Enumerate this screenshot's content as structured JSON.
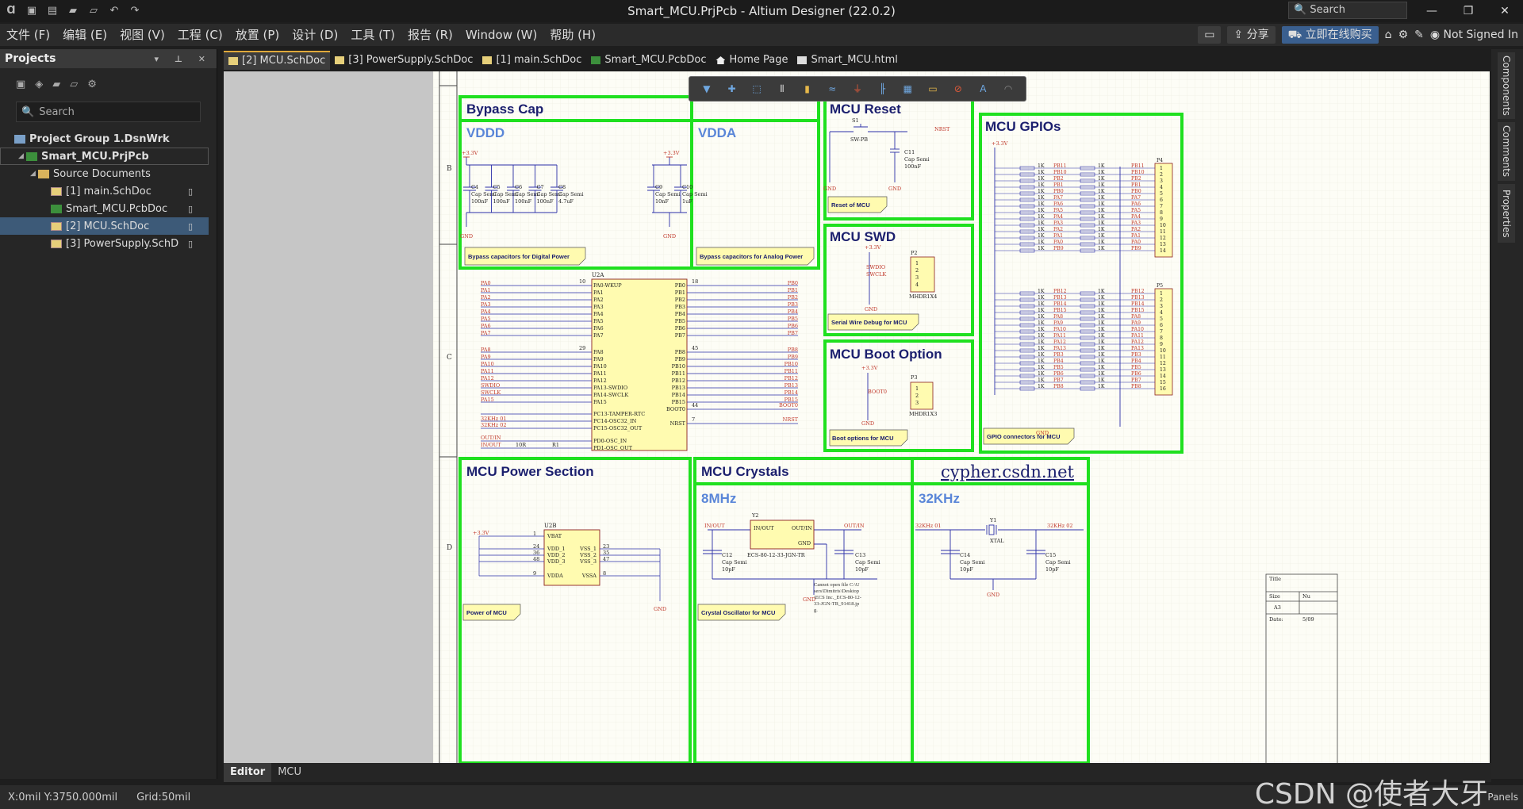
{
  "window": {
    "title": "Smart_MCU.PrjPcb - Altium Designer (22.0.2)",
    "search_placeholder": "Search"
  },
  "menu": [
    "文件 (F)",
    "编辑 (E)",
    "视图 (V)",
    "工程 (C)",
    "放置 (P)",
    "设计 (D)",
    "工具 (T)",
    "报告 (R)",
    "Window (W)",
    "帮助 (H)"
  ],
  "menu_right": {
    "share": "分享",
    "buy": "立即在线购买",
    "account": "Not Signed In"
  },
  "projects_panel": {
    "title": "Projects",
    "search_placeholder": "Search",
    "tree": [
      {
        "label": "Project Group 1.DsnWrk"
      },
      {
        "label": "Smart_MCU.PrjPcb"
      },
      {
        "label": "Source Documents"
      },
      {
        "label": "[1] main.SchDoc"
      },
      {
        "label": "Smart_MCU.PcbDoc"
      },
      {
        "label": "[2] MCU.SchDoc"
      },
      {
        "label": "[3] PowerSupply.SchD"
      }
    ]
  },
  "doc_tabs": [
    "[2] MCU.SchDoc",
    "[3] PowerSupply.SchDoc",
    "[1] main.SchDoc",
    "Smart_MCU.PcbDoc",
    "Home Page",
    "Smart_MCU.html"
  ],
  "right_panels": [
    "Components",
    "Comments",
    "Properties"
  ],
  "bottom_tabs": [
    "Editor",
    "MCU"
  ],
  "status": {
    "coords": "X:0mil Y:3750.000mil",
    "grid": "Grid:50mil",
    "panels": "Panels"
  },
  "watermark": "CSDN @使者大牙",
  "schematic": {
    "border_letters": [
      "B",
      "C",
      "D"
    ],
    "titles": {
      "bypass": "Bypass Cap",
      "vddd": "VDDD",
      "vdda": "VDDA",
      "reset": "MCU Reset",
      "gpio": "MCU GPIOs",
      "swd": "MCU SWD",
      "boot": "MCU Boot Option",
      "power": "MCU Power Section",
      "crystals": "MCU Crystals",
      "url": "cypher.csdn.net",
      "mhz8": "8MHz",
      "khz32": "32KHz"
    },
    "notes": {
      "digital": "Bypass capacitors for Digital Power",
      "analog": "Bypass capacitors for Analog Power",
      "reset": "Reset of MCU",
      "swd": "Serial Wire Debug for MCU",
      "boot": "Boot options for MCU",
      "gpio": "GPIO connectors for MCU",
      "power": "Power of MCU",
      "crystal": "Crystal Oscillator for MCU"
    },
    "net_labels": {
      "v33": "+3.3V",
      "gnd": "GND",
      "nrst": "NRST",
      "swdio": "SWDIO",
      "swclk": "SWCLK",
      "boot0": "BOOT0",
      "outin": "OUT/IN",
      "inout": "IN/OUT",
      "k32_01": "32KHz 01",
      "k32_02": "32KHz 02"
    },
    "caps_vddd": [
      {
        "ref": "C4",
        "type": "Cap Semi",
        "val": "100nF"
      },
      {
        "ref": "C5",
        "type": "Cap Semi",
        "val": "100nF"
      },
      {
        "ref": "C6",
        "type": "Cap Semi",
        "val": "100nF"
      },
      {
        "ref": "C7",
        "type": "Cap Semi",
        "val": "100nF"
      },
      {
        "ref": "C8",
        "type": "Cap Semi",
        "val": "4.7uF"
      }
    ],
    "caps_vdda": [
      {
        "ref": "C9",
        "type": "Cap Semi",
        "val": "10nF"
      },
      {
        "ref": "C10",
        "type": "Cap Semi",
        "val": "1uF"
      }
    ],
    "reset": {
      "sw": "S1",
      "sw_type": "SW-PB",
      "cap": "C11",
      "cap_type": "Cap Semi",
      "cap_val": "100nF"
    },
    "swd": {
      "ref": "P2",
      "part": "MHDR1X4",
      "pins": [
        "1",
        "2",
        "3",
        "4"
      ]
    },
    "boot": {
      "ref": "P3",
      "part": "MHDR1X3",
      "pins": [
        "1",
        "2",
        "3"
      ]
    },
    "mcu": {
      "ref": "U2A",
      "left_nets": [
        "PA0",
        "PA1",
        "PA2",
        "PA3",
        "PA4",
        "PA5",
        "PA6",
        "PA7",
        "PA8",
        "PA9",
        "PA10",
        "PA11",
        "PA12",
        "SWDIO",
        "SWCLK",
        "PA15"
      ],
      "left_pins": [
        "PA0-WKUP",
        "PA1",
        "PA2",
        "PA3",
        "PA4",
        "PA5",
        "PA6",
        "PA7",
        "PA8",
        "PA9",
        "PA10",
        "PA11",
        "PA12",
        "PA13-SWDIO",
        "PA14-SWCLK",
        "PA15"
      ],
      "left_num_first": "10",
      "left_num_mid": "29",
      "right_pins": [
        "PB0",
        "PB1",
        "PB2",
        "PB3",
        "PB4",
        "PB5",
        "PB6",
        "PB7",
        "PB8",
        "PB9",
        "PB10",
        "PB11",
        "PB12",
        "PB13",
        "PB14",
        "PB15"
      ],
      "right_num_first": "18",
      "right_num_mid": "45",
      "osc_pins": [
        "PC13-TAMPER-RTC",
        "PC14-OSC32_IN",
        "PC15-OSC32_OUT"
      ],
      "osc_nets": [
        "32KHz 01",
        "32KHz 02"
      ],
      "pd_pins": [
        "PD0-OSC_IN",
        "PD1-OSC_OUT"
      ],
      "pd_nets": [
        "OUT/IN",
        "IN/OUT"
      ],
      "boot_pin": "BOOT0",
      "boot_num": "44",
      "nrst_pin": "NRST",
      "nrst_num": "7",
      "r1": "R1",
      "r1_val": "10R"
    },
    "gpio": {
      "p4": "P4",
      "p5": "P5",
      "val": "1K",
      "p4_nets": [
        "PB11",
        "PB10",
        "PB2",
        "PB1",
        "PB0",
        "PA7",
        "PA6",
        "PA5",
        "PA4",
        "PA3",
        "PA2",
        "PA1",
        "PA0",
        "PB9"
      ],
      "p5_nets": [
        "PB12",
        "PB13",
        "PB14",
        "PB15",
        "PA8",
        "PA9",
        "PA10",
        "PA11",
        "PA12",
        "PA13",
        "PB3",
        "PB4",
        "PB5",
        "PB6",
        "PB7",
        "PB8"
      ]
    },
    "power": {
      "ref": "U2B",
      "left_pins": [
        "VBAT",
        "VDD_1",
        "VDD_2",
        "VDD_3",
        "VDDA"
      ],
      "left_nums": [
        "1",
        "24",
        "36",
        "48",
        "9"
      ],
      "right_pins": [
        "VSS_1",
        "VSS_2",
        "VSS_3",
        "VSSA"
      ],
      "right_nums": [
        "23",
        "35",
        "47",
        "8"
      ]
    },
    "crystal8": {
      "ref": "Y2",
      "part": "ECS-80-12-33-JGN-TR",
      "pin_in": "IN/OUT",
      "pin_out": "OUT/IN",
      "pin_gnd": "GND",
      "c12": "C12",
      "c13": "C13",
      "cap_type": "Cap Semi",
      "cap_val": "10pF",
      "error": "Cannot open file C:\\Users\\Dimitris\\Desktop\\ECS Inc._ECS-80-12-33-JGN-TR_91418.jpg."
    },
    "crystal32": {
      "ref": "Y1",
      "part": "XTAL",
      "c14": "C14",
      "c15": "C15",
      "cap_type": "Cap Semi",
      "cap_val": "10pF"
    },
    "titleblock": {
      "title": "Title",
      "size": "Size",
      "size_val": "A3",
      "date": "Date:",
      "date_val": "5/09",
      "num": "Nu"
    }
  }
}
